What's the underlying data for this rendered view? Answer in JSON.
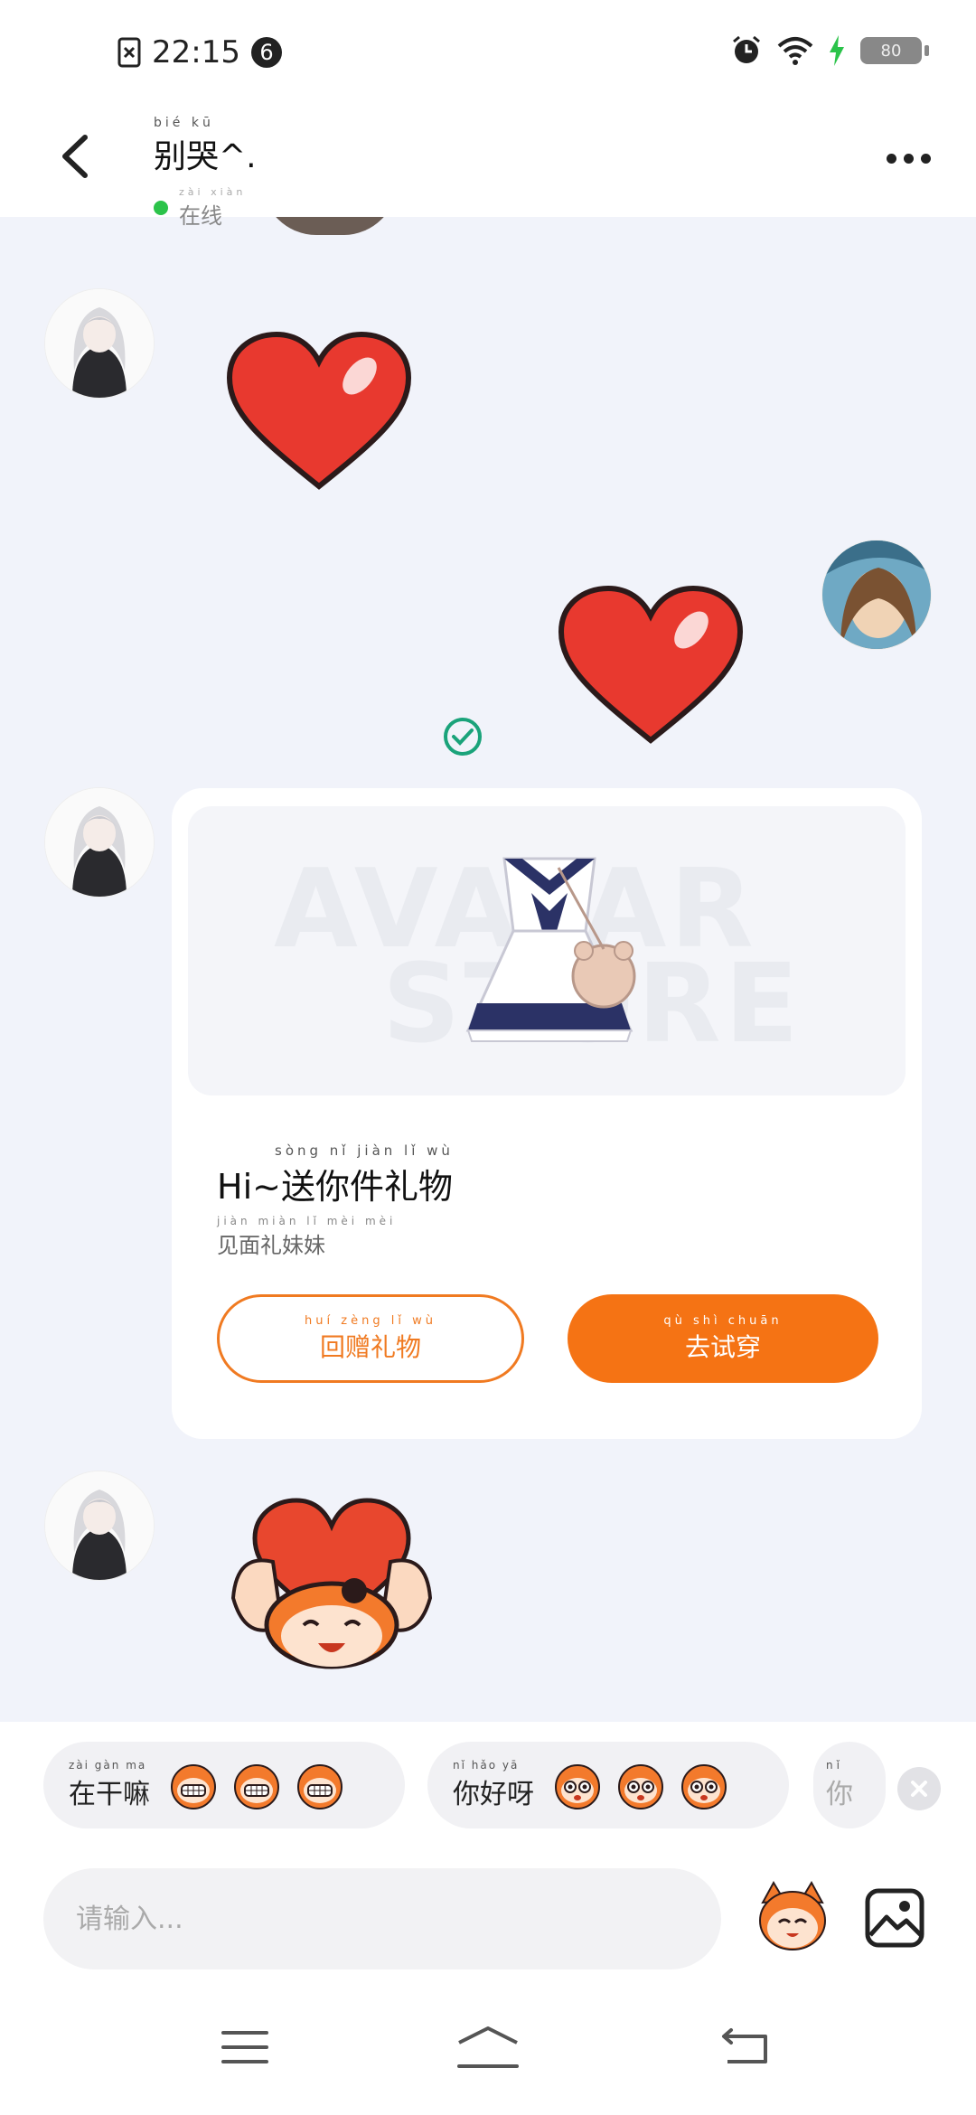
{
  "status_bar": {
    "time": "22:15",
    "notification_count": "6",
    "battery": "80"
  },
  "header": {
    "title_pinyin": "bié   kū",
    "title": "别哭^.",
    "status_pinyin": "zài  xiàn",
    "status": "在线"
  },
  "gift_card": {
    "watermark_line1": "AVATAR",
    "watermark_line2": "STORE",
    "title_pinyin": "sòng  nǐ  jiàn  lǐ   wù",
    "title": "Hi~送你件礼物",
    "subtitle_pinyin": "jiàn miàn  lǐ   mèi  mèi",
    "subtitle": "见面礼妹妹",
    "return_pinyin": "huí zèng  lǐ   wù",
    "return_label": "回赠礼物",
    "try_pinyin": "qù  shì chuān",
    "try_label": "去试穿"
  },
  "quick_replies": [
    {
      "pinyin": "zài  gàn  ma",
      "text": "在干嘛",
      "emoji": "grinning-monkey"
    },
    {
      "pinyin": "nǐ  hǎo  yā",
      "text": "你好呀",
      "emoji": "wide-eyed-monkey"
    },
    {
      "pinyin": "nǐ",
      "text": "你"
    }
  ],
  "input": {
    "placeholder": "请输入..."
  },
  "colors": {
    "accent": "#f57314",
    "online": "#2bc34a",
    "check": "#1aa37a",
    "heart": "#e8392f"
  },
  "icons": [
    "back-arrow",
    "more-dots",
    "check-circle",
    "close",
    "mascot",
    "image",
    "menu",
    "home",
    "back"
  ]
}
